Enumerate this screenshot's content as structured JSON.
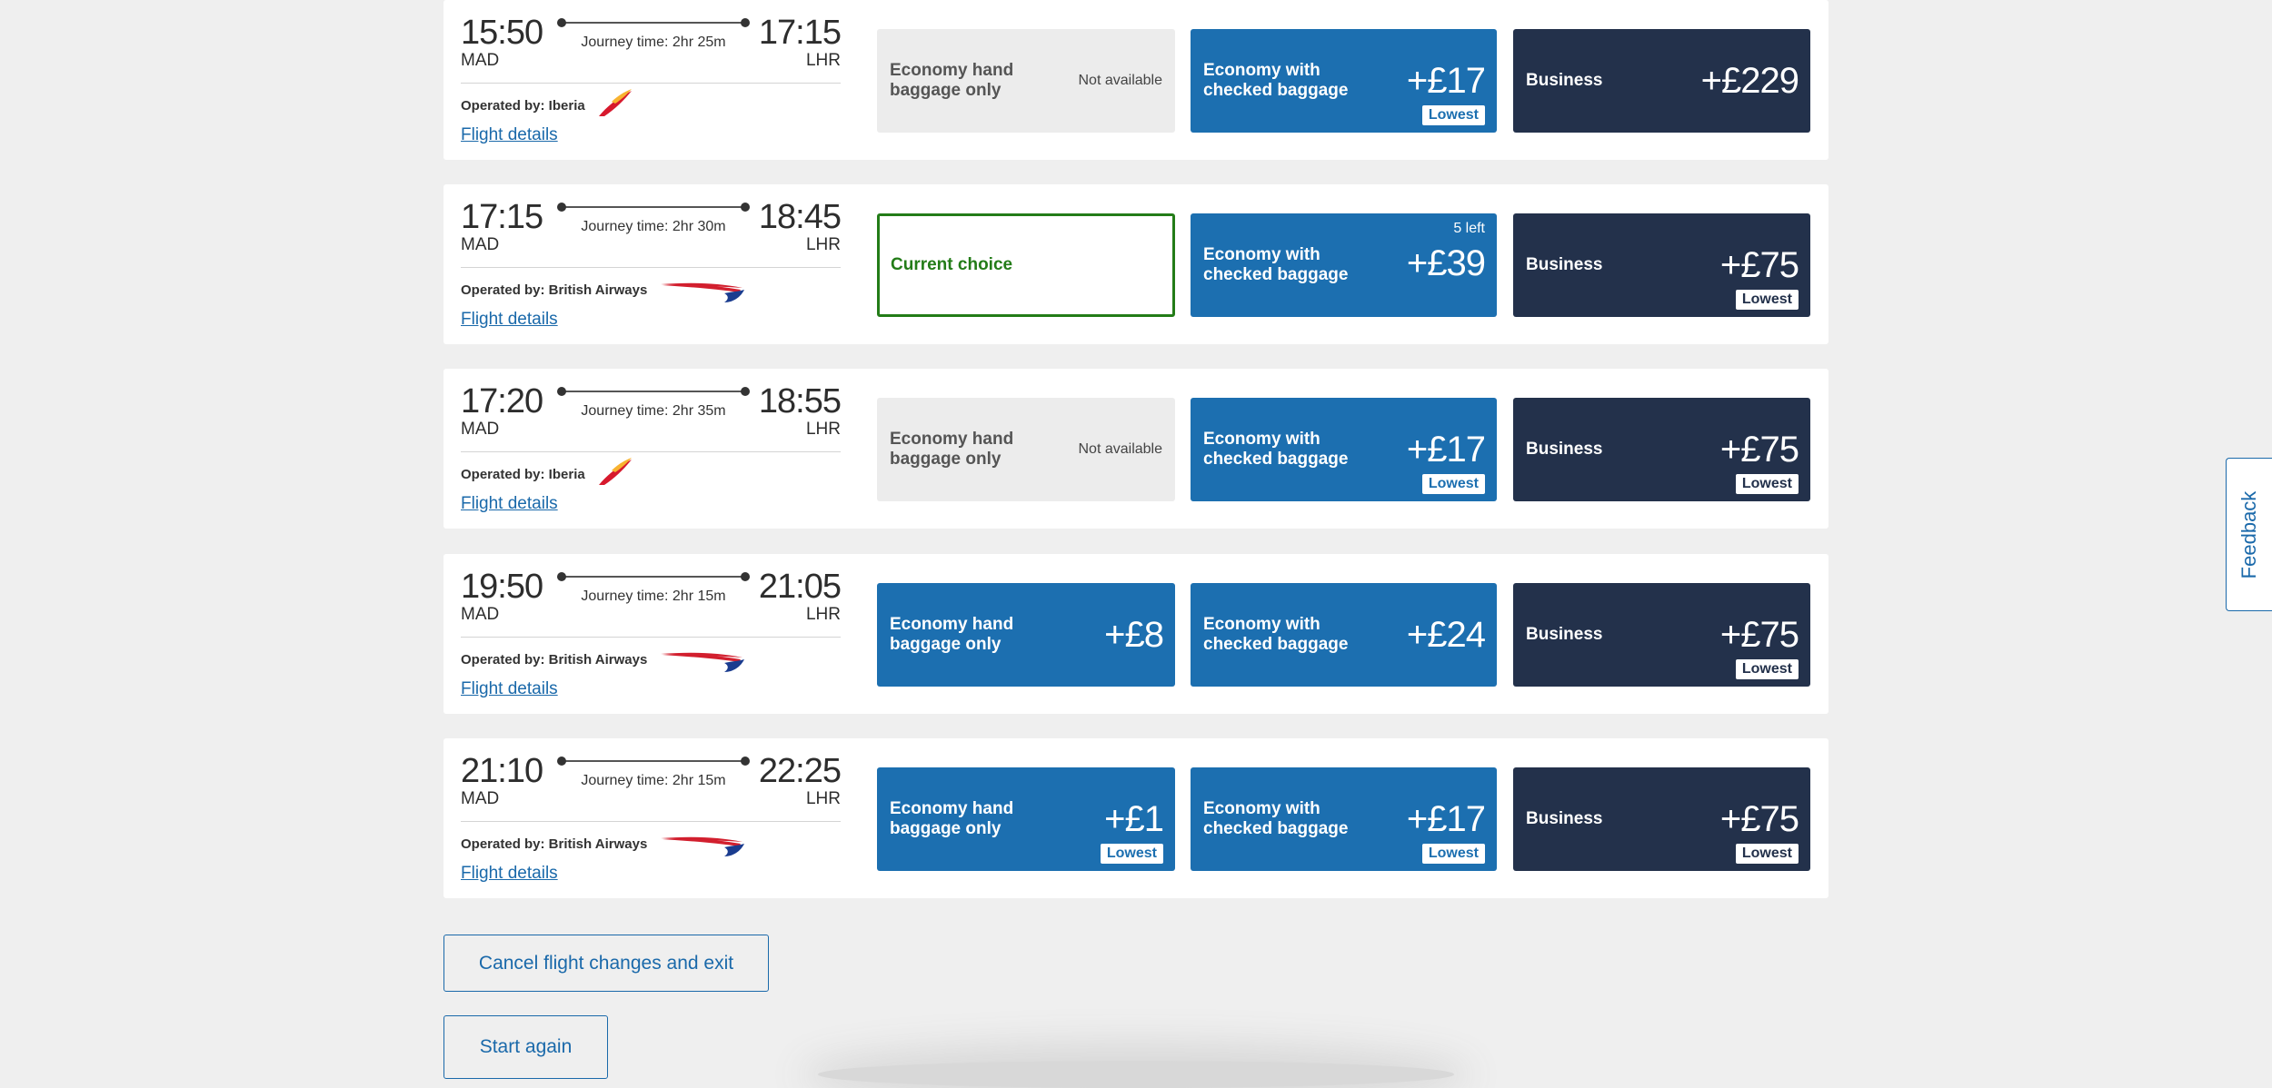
{
  "flights": [
    {
      "dep_time": "15:50",
      "dep_code": "MAD",
      "arr_time": "17:15",
      "arr_code": "LHR",
      "journey": "Journey time: 2hr 25m",
      "operated_label": "Operated by: Iberia",
      "airline": "iberia",
      "details": "Flight details",
      "fares": [
        {
          "name": "Economy hand baggage only",
          "status": "Not available"
        },
        {
          "name": "Economy with checked baggage",
          "price": "+£17",
          "badge": "Lowest"
        },
        {
          "name": "Business",
          "price": "+£229"
        }
      ]
    },
    {
      "dep_time": "17:15",
      "dep_code": "MAD",
      "arr_time": "18:45",
      "arr_code": "LHR",
      "journey": "Journey time: 2hr 30m",
      "operated_label": "Operated by: British Airways",
      "airline": "ba",
      "details": "Flight details",
      "fares": [
        {
          "name": "Current choice"
        },
        {
          "name": "Economy with checked baggage",
          "price": "+£39",
          "seats": "5 left"
        },
        {
          "name": "Business",
          "price": "+£75",
          "badge": "Lowest"
        }
      ]
    },
    {
      "dep_time": "17:20",
      "dep_code": "MAD",
      "arr_time": "18:55",
      "arr_code": "LHR",
      "journey": "Journey time: 2hr 35m",
      "operated_label": "Operated by: Iberia",
      "airline": "iberia",
      "details": "Flight details",
      "fares": [
        {
          "name": "Economy hand baggage only",
          "status": "Not available"
        },
        {
          "name": "Economy with checked baggage",
          "price": "+£17",
          "badge": "Lowest"
        },
        {
          "name": "Business",
          "price": "+£75",
          "badge": "Lowest"
        }
      ]
    },
    {
      "dep_time": "19:50",
      "dep_code": "MAD",
      "arr_time": "21:05",
      "arr_code": "LHR",
      "journey": "Journey time: 2hr 15m",
      "operated_label": "Operated by: British Airways",
      "airline": "ba",
      "details": "Flight details",
      "fares": [
        {
          "name": "Economy hand baggage only",
          "price": "+£8"
        },
        {
          "name": "Economy with checked baggage",
          "price": "+£24"
        },
        {
          "name": "Business",
          "price": "+£75",
          "badge": "Lowest"
        }
      ]
    },
    {
      "dep_time": "21:10",
      "dep_code": "MAD",
      "arr_time": "22:25",
      "arr_code": "LHR",
      "journey": "Journey time: 2hr 15m",
      "operated_label": "Operated by: British Airways",
      "airline": "ba",
      "details": "Flight details",
      "fares": [
        {
          "name": "Economy hand baggage only",
          "price": "+£1",
          "badge": "Lowest"
        },
        {
          "name": "Economy with checked baggage",
          "price": "+£17",
          "badge": "Lowest"
        },
        {
          "name": "Business",
          "price": "+£75",
          "badge": "Lowest"
        }
      ]
    }
  ],
  "actions": {
    "cancel_label": "Cancel flight changes and exit",
    "start_again_label": "Start again"
  },
  "feedback_label": "Feedback",
  "colors": {
    "fare_blue": "#1c6fb0",
    "fare_navy": "#23314b",
    "current_green": "#237c18",
    "link_blue": "#1a69aa",
    "page_bg": "#efefef"
  }
}
